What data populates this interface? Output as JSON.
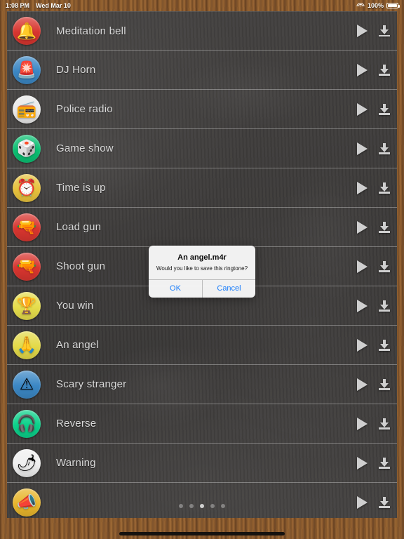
{
  "statusbar": {
    "time": "1:08 PM",
    "date": "Wed Mar 10",
    "wifi_icon": "wifi-icon",
    "battery_percent": "100%",
    "battery_icon": "battery-full-icon"
  },
  "list": {
    "rows": [
      {
        "label": "Meditation bell",
        "icon_glyph": "🔔",
        "icon_name": "bell-icon",
        "icon_bg": "#d8352f"
      },
      {
        "label": "DJ Horn",
        "icon_glyph": "🚨",
        "icon_name": "siren-icon",
        "icon_bg": "#3b87c4"
      },
      {
        "label": "Police radio",
        "icon_glyph": "📻",
        "icon_name": "radio-icon",
        "icon_bg": "#e9e9e9"
      },
      {
        "label": "Game show",
        "icon_glyph": "🎲",
        "icon_name": "dice-icon",
        "icon_bg": "#0bbf72"
      },
      {
        "label": "Time is up",
        "icon_glyph": "⏰",
        "icon_name": "alarm-clock-icon",
        "icon_bg": "#e8c23c"
      },
      {
        "label": "Load gun",
        "icon_glyph": "🔫",
        "icon_name": "pistol-green-icon",
        "icon_bg": "#d8352f"
      },
      {
        "label": "Shoot gun",
        "icon_glyph": "🔫",
        "icon_name": "pistol-dark-icon",
        "icon_bg": "#d8352f"
      },
      {
        "label": "You win",
        "icon_glyph": "🏆",
        "icon_name": "trophy-icon",
        "icon_bg": "#e6dd4b"
      },
      {
        "label": "An angel",
        "icon_glyph": "🙏",
        "icon_name": "praying-hands-icon",
        "icon_bg": "#e3d948"
      },
      {
        "label": "Scary stranger",
        "icon_glyph": "⚠",
        "icon_name": "warning-triangle-icon",
        "icon_bg": "#3b87c4"
      },
      {
        "label": "Reverse",
        "icon_glyph": "🎧",
        "icon_name": "headphones-icon",
        "icon_bg": "#0bd18a"
      },
      {
        "label": "Warning",
        "icon_glyph": "🌶",
        "icon_name": "chili-pepper-icon",
        "icon_bg": "#efefef"
      },
      {
        "label": "",
        "icon_glyph": "📣",
        "icon_name": "megaphone-icon",
        "icon_bg": "#e8b62c"
      }
    ],
    "play_icon": "play-icon",
    "download_icon": "download-icon"
  },
  "pagination": {
    "count": 5,
    "active_index": 2
  },
  "alert": {
    "title": "An angel.m4r",
    "message": "Would you like to save this ringtone?",
    "ok_label": "OK",
    "cancel_label": "Cancel",
    "accent_color": "#1a7dfa"
  }
}
